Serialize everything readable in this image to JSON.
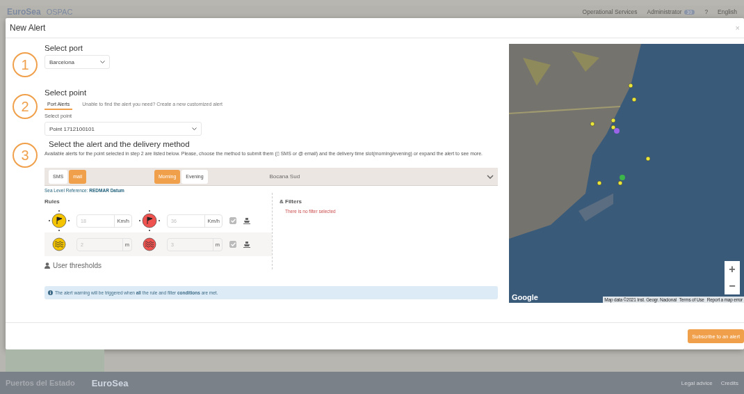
{
  "background": {
    "brand": "EuroSea",
    "app": "OSPAC",
    "nav": [
      {
        "label": "Operational Services"
      },
      {
        "label": "Administrator",
        "badge": "30"
      },
      {
        "label": "?"
      },
      {
        "label": "English"
      }
    ],
    "footer": {
      "org": "Puertos del Estado",
      "project": "EuroSea",
      "links": [
        "Legal advice",
        "Credits"
      ]
    }
  },
  "dialog": {
    "title": "New Alert",
    "close": "×",
    "steps": [
      {
        "number": "1",
        "title": "Select port",
        "select": "Barcelona"
      },
      {
        "number": "2",
        "title": "Select point",
        "tabs": [
          {
            "label": "Port Alerts",
            "selected": true
          },
          {
            "label": "Unable to find the alert you need? Create a new customized alert",
            "selected": false
          }
        ],
        "field_label": "Select point",
        "select": "Point 1712100101"
      },
      {
        "number": "3",
        "title": "Select the alert and the delivery method",
        "description": "Available alerts for the point selected in step 2 are listed below. Please, choose the method to submit them (▯ SMS or @ email) and the delivery time slot(morning/evening) or expand the alert to see more."
      }
    ],
    "alert": {
      "methods": [
        {
          "label": "SMS",
          "selected": false
        },
        {
          "label": "mail",
          "selected": true
        }
      ],
      "slots": [
        {
          "label": "Morning",
          "selected": true
        },
        {
          "label": "Evening",
          "selected": false
        }
      ],
      "location": "Bocana Sud",
      "expanded": true,
      "sea_level": "Sea Level Reference: **REDMAR Datum**",
      "rules_title": "Rules",
      "rules": [
        {
          "kind": "wind",
          "checked": true,
          "thresholds": [
            {
              "color": "#f5c400",
              "value": "18",
              "unit": "Km/h"
            },
            {
              "color": "#ef5350",
              "value": "36",
              "unit": "Km/h"
            }
          ]
        },
        {
          "kind": "wave",
          "checked": true,
          "thresholds": [
            {
              "color": "#f5c400",
              "value": "2",
              "unit": "m"
            },
            {
              "color": "#ef5350",
              "value": "3",
              "unit": "m"
            }
          ]
        }
      ],
      "user_thresholds": "User thresholds",
      "filters_title": "& Filters",
      "filters_empty": "There is no filter selected",
      "info": "The alert warning will be triggered when **all** the rule and filter **conditions** are met."
    },
    "map": {
      "kind": "picture",
      "zoom_in": "+",
      "zoom_out": "−",
      "logo": "Google",
      "attribution": [
        "Map data ©2021 Inst. Geogr. Nacional",
        "Terms of Use",
        "Report a map error"
      ]
    },
    "submit": "Subscribe to an alert"
  }
}
